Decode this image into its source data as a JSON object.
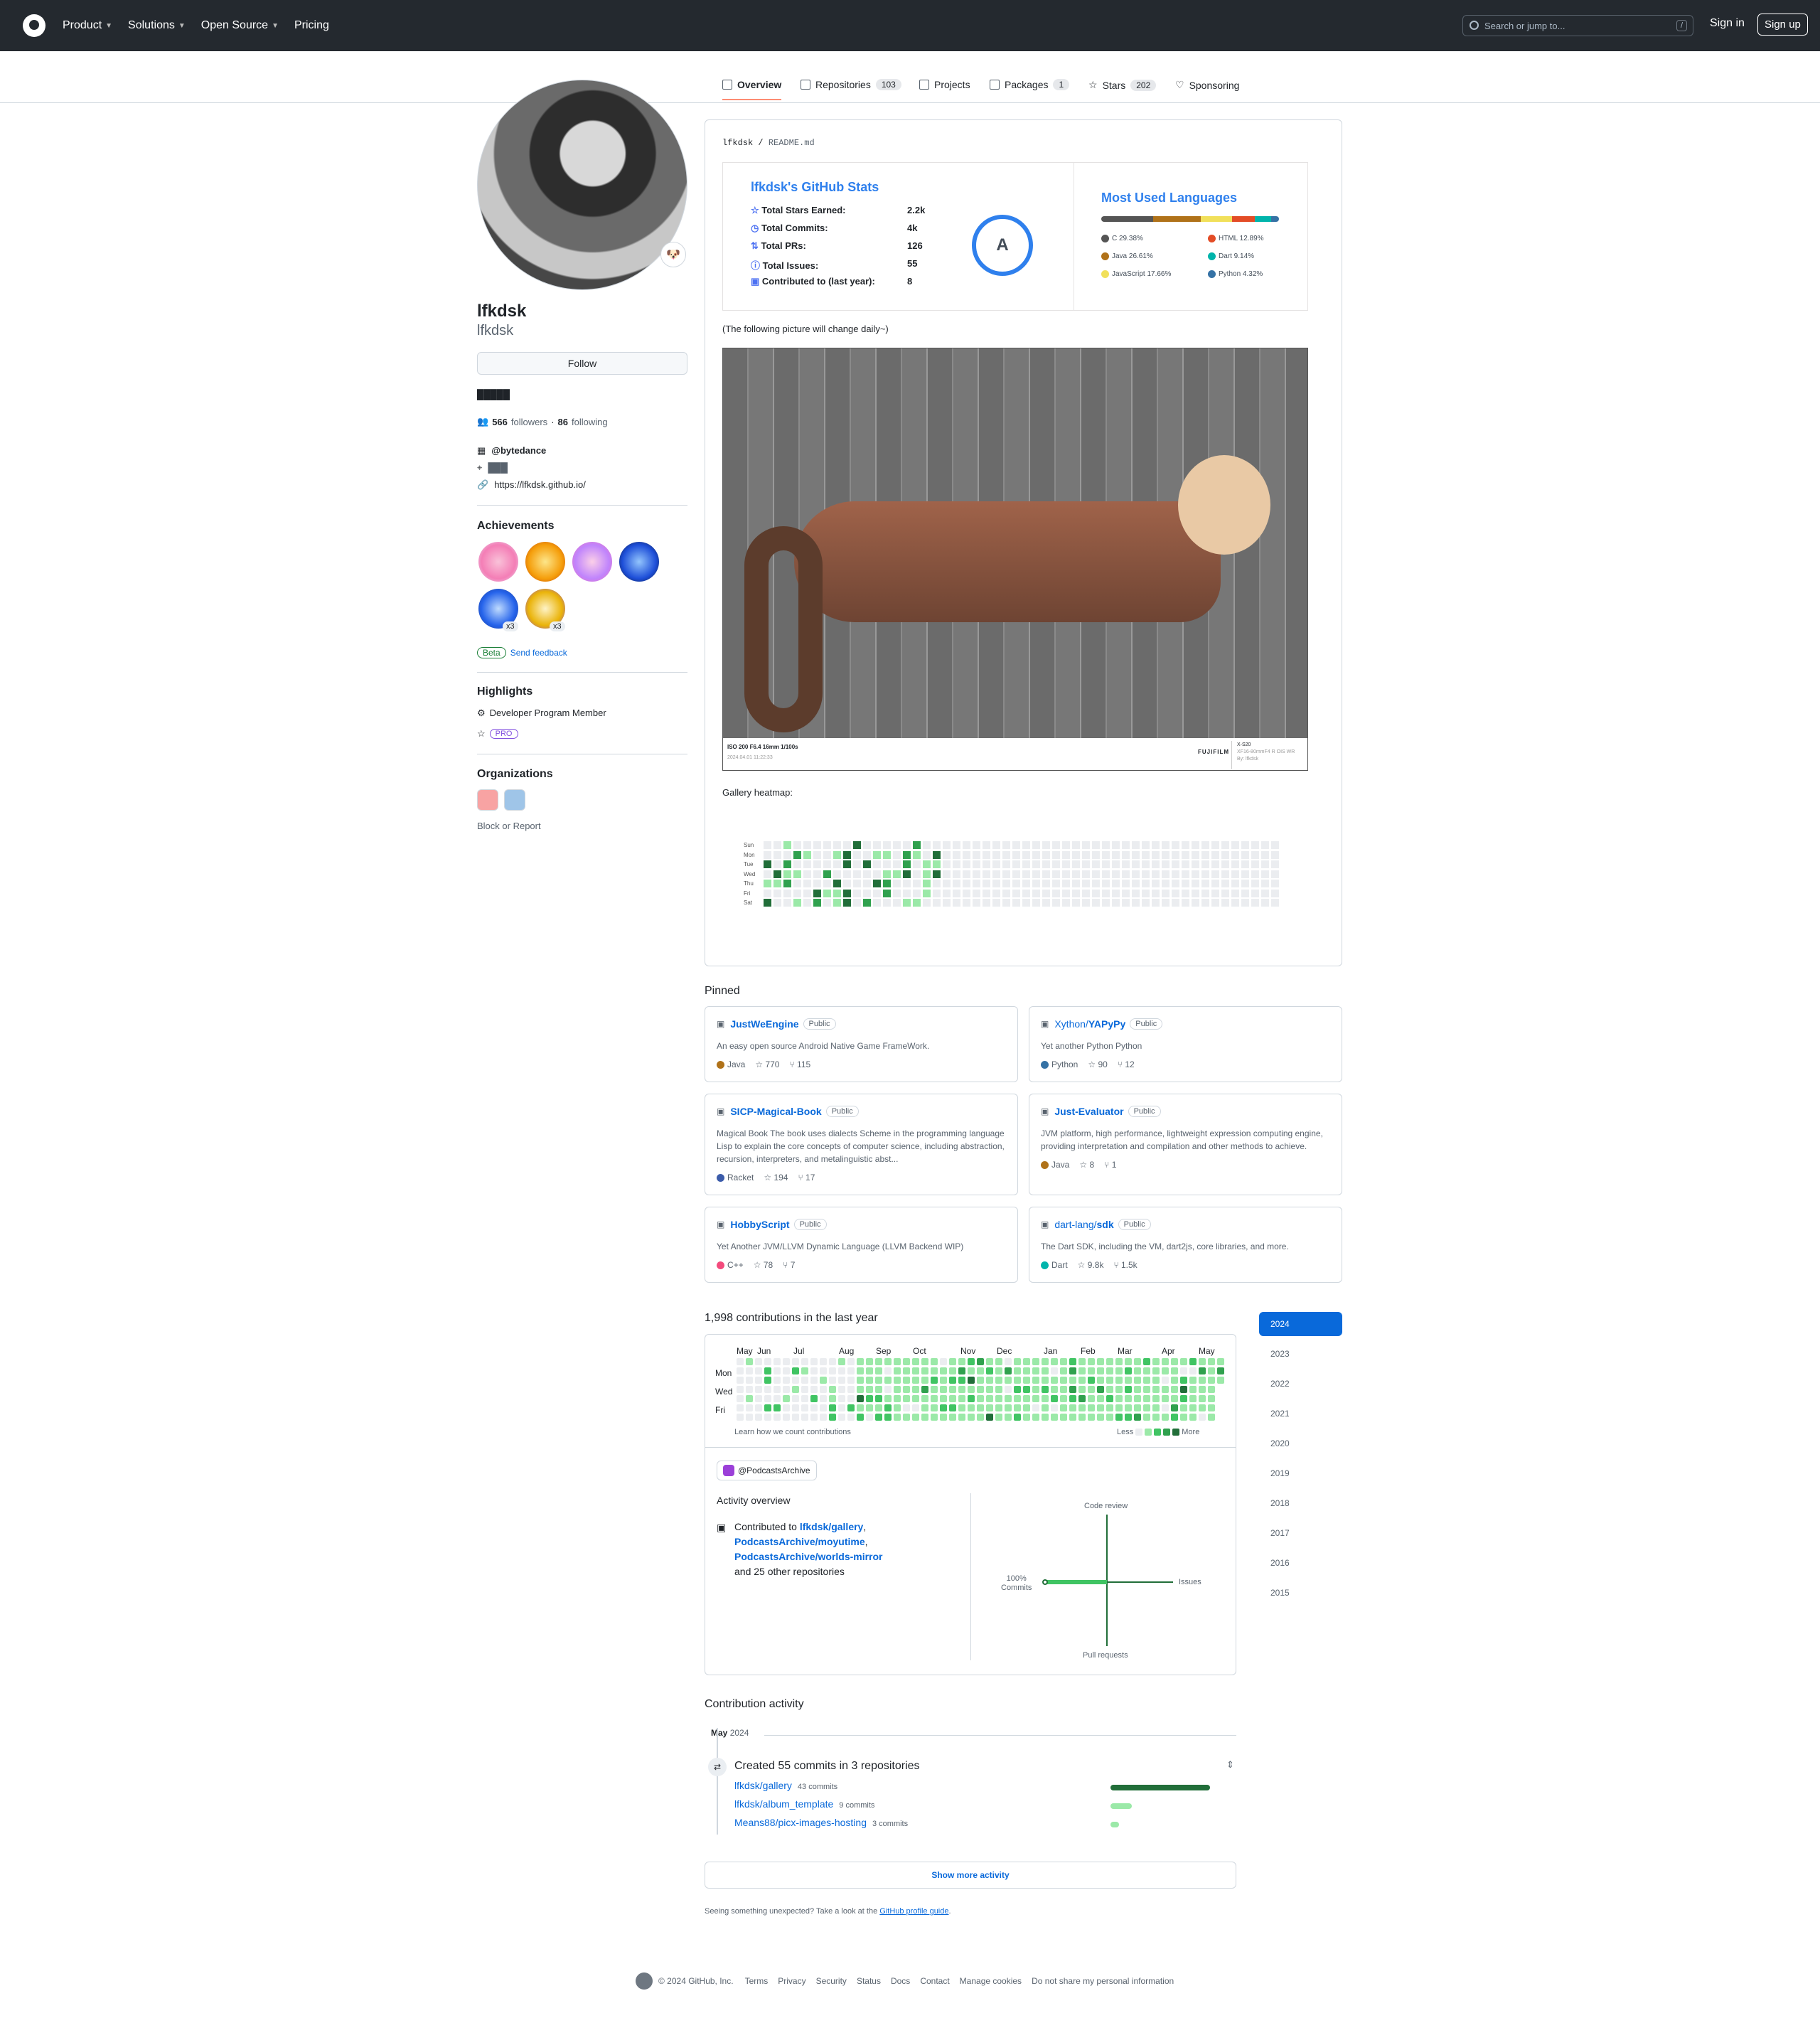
{
  "header": {
    "nav": [
      "Product",
      "Solutions",
      "Open Source",
      "Pricing"
    ],
    "search_placeholder": "Search or jump to...",
    "slash": "/",
    "signin": "Sign in",
    "signup": "Sign up"
  },
  "tabs": [
    {
      "label": "Overview"
    },
    {
      "label": "Repositories",
      "count": "103"
    },
    {
      "label": "Projects"
    },
    {
      "label": "Packages",
      "count": "1"
    },
    {
      "label": "Stars",
      "count": "202"
    },
    {
      "label": "Sponsoring"
    }
  ],
  "profile": {
    "name": "lfkdsk",
    "username": "lfkdsk",
    "emoji": "🐶",
    "follow": "Follow",
    "bio": "█████",
    "followers": "566",
    "followers_label": "followers",
    "following": "86",
    "following_label": "following",
    "company": "@bytedance",
    "location": "███",
    "website": "https://lfkdsk.github.io/"
  },
  "achievements": {
    "title": "Achievements",
    "x1": "x3",
    "x2": "x3",
    "beta": "Beta",
    "feedback": "Send feedback"
  },
  "highlights": {
    "title": "Highlights",
    "dev": "Developer Program Member",
    "pro": "PRO"
  },
  "orgs": {
    "title": "Organizations",
    "block": "Block or Report"
  },
  "readme": {
    "path_user": "lfkdsk",
    "path_file": "README.md",
    "stats_title": "lfkdsk's GitHub Stats",
    "rows": [
      {
        "label": "Total Stars Earned:",
        "value": "2.2k"
      },
      {
        "label": "Total Commits:",
        "value": "4k"
      },
      {
        "label": "Total PRs:",
        "value": "126"
      },
      {
        "label": "Total Issues:",
        "value": "55"
      },
      {
        "label": "Contributed to (last year):",
        "value": "8"
      }
    ],
    "grade": "A",
    "lang_title": "Most Used Languages",
    "langs": [
      {
        "name": "C 29.38%",
        "color": "#555555"
      },
      {
        "name": "HTML 12.89%",
        "color": "#e34c26"
      },
      {
        "name": "Java 26.61%",
        "color": "#b07219"
      },
      {
        "name": "Dart 9.14%",
        "color": "#00b4ab"
      },
      {
        "name": "JavaScript 17.66%",
        "color": "#f1e05a"
      },
      {
        "name": "Python 4.32%",
        "color": "#3572a5"
      }
    ],
    "note": "(The following picture will change daily~)",
    "photo_info": "ISO 200 F6.4 16mm 1/100s",
    "photo_date": "2024.04.01 11:22:33",
    "brand": "FUJIFILM",
    "model": "X-S20",
    "lens": "XF16-80mmF4 R OIS WR",
    "by": "By: lfkdsk",
    "heatmap_label": "Gallery heatmap:",
    "days": [
      "Sun",
      "Mon",
      "Tue",
      "Wed",
      "Thu",
      "Fri",
      "Sat"
    ]
  },
  "pinned": {
    "title": "Pinned",
    "public": "Public",
    "items": [
      {
        "owner": "",
        "name": "JustWeEngine",
        "desc": "An easy open source Android Native Game FrameWork.",
        "lang": "Java",
        "color": "#b07219",
        "stars": "770",
        "forks": "115"
      },
      {
        "owner": "Xython/",
        "name": "YAPyPy",
        "desc": "Yet another Python Python",
        "lang": "Python",
        "color": "#3572a5",
        "stars": "90",
        "forks": "12"
      },
      {
        "owner": "",
        "name": "SICP-Magical-Book",
        "desc": "Magical Book The book uses dialects Scheme in the programming language Lisp to explain the core concepts of computer science, including abstraction, recursion, interpreters, and metalinguistic abst...",
        "lang": "Racket",
        "color": "#3c5caa",
        "stars": "194",
        "forks": "17"
      },
      {
        "owner": "",
        "name": "Just-Evaluator",
        "desc": "JVM platform, high performance, lightweight expression computing engine, providing interpretation and compilation and other methods to achieve.",
        "lang": "Java",
        "color": "#b07219",
        "stars": "8",
        "forks": "1"
      },
      {
        "owner": "",
        "name": "HobbyScript",
        "desc": "Yet Another JVM/LLVM Dynamic Language (LLVM Backend WIP)",
        "lang": "C++",
        "color": "#f34b7d",
        "stars": "78",
        "forks": "7"
      },
      {
        "owner": "dart-lang/",
        "name": "sdk",
        "desc": "The Dart SDK, including the VM, dart2js, core libraries, and more.",
        "lang": "Dart",
        "color": "#00b4ab",
        "stars": "9.8k",
        "forks": "1.5k"
      }
    ]
  },
  "contrib": {
    "title": "1,998 contributions in the last year",
    "months": [
      "May",
      "Jun",
      "Jul",
      "Aug",
      "Sep",
      "Oct",
      "Nov",
      "Dec",
      "Jan",
      "Feb",
      "Mar",
      "Apr",
      "May"
    ],
    "days": [
      "Mon",
      "Wed",
      "Fri"
    ],
    "learn": "Learn how we count contributions",
    "less": "Less",
    "more": "More",
    "years": [
      "2024",
      "2023",
      "2022",
      "2021",
      "2020",
      "2019",
      "2018",
      "2017",
      "2016",
      "2015"
    ],
    "org": "@PodcastsArchive",
    "overview": "Activity overview",
    "contributed": "Contributed to",
    "repo1": "lfkdsk/gallery",
    "repo2": "PodcastsArchive/moyutime",
    "repo3": "PodcastsArchive/worlds-mirror",
    "others": "and 25 other repositories",
    "axis": {
      "top": "Code review",
      "left1": "100%",
      "left2": "Commits",
      "right": "Issues",
      "bottom": "Pull requests"
    }
  },
  "activity": {
    "title": "Contribution activity",
    "month": "May",
    "year": "2024",
    "created": "Created 55 commits in 3 repositories",
    "repos": [
      {
        "name": "lfkdsk/gallery",
        "count": "43 commits"
      },
      {
        "name": "lfkdsk/album_template",
        "count": "9 commits"
      },
      {
        "name": "Means88/picx-images-hosting",
        "count": "3 commits"
      }
    ],
    "more": "Show more activity",
    "unexpected": "Seeing something unexpected? Take a look at the",
    "guide": "GitHub profile guide",
    "dot": "."
  },
  "footer": {
    "copy": "© 2024 GitHub, Inc.",
    "links": [
      "Terms",
      "Privacy",
      "Security",
      "Status",
      "Docs",
      "Contact",
      "Manage cookies",
      "Do not share my personal information"
    ]
  }
}
